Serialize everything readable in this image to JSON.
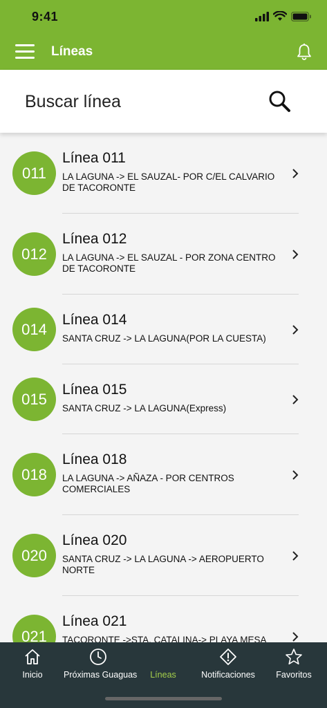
{
  "status_bar": {
    "time": "9:41"
  },
  "app_bar": {
    "title": "Líneas"
  },
  "search": {
    "placeholder": "Buscar línea"
  },
  "lines": [
    {
      "code": "011",
      "title": "Línea 011",
      "route": "LA LAGUNA -> EL SAUZAL- POR C/EL CALVARIO DE TACORONTE"
    },
    {
      "code": "012",
      "title": "Línea 012",
      "route": "LA LAGUNA -> EL SAUZAL - POR ZONA CENTRO DE TACORONTE"
    },
    {
      "code": "014",
      "title": "Línea 014",
      "route": "SANTA CRUZ -> LA LAGUNA(POR LA CUESTA)"
    },
    {
      "code": "015",
      "title": "Línea 015",
      "route": "SANTA CRUZ -> LA LAGUNA(Express)"
    },
    {
      "code": "018",
      "title": "Línea 018",
      "route": "LA LAGUNA -> AÑAZA -  POR CENTROS COMERCIALES"
    },
    {
      "code": "020",
      "title": "Línea 020",
      "route": "SANTA CRUZ -> LA LAGUNA -> AEROPUERTO  NORTE"
    },
    {
      "code": "021",
      "title": "Línea 021",
      "route": "TACORONTE ->STA. CATALINA-> PLAYA MESA"
    }
  ],
  "tabs": [
    {
      "label": "Inicio",
      "icon": "home-icon"
    },
    {
      "label": "Próximas Guaguas",
      "icon": "clock-icon"
    },
    {
      "label": "Líneas",
      "icon": "bus-icon"
    },
    {
      "label": "Notificaciones",
      "icon": "alert-icon"
    },
    {
      "label": "Favoritos",
      "icon": "star-icon"
    }
  ],
  "colors": {
    "primary": "#7cb532",
    "tabbar": "#28373b",
    "tab_active": "#a5cf4b"
  }
}
